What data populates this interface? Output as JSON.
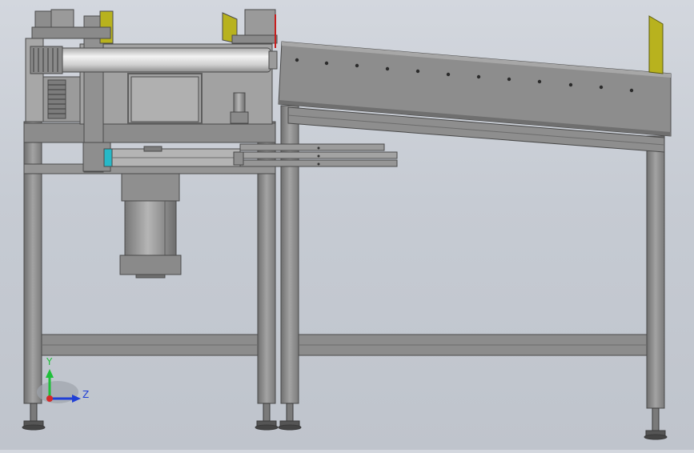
{
  "viewport": {
    "view_name": "cad-front-view",
    "background": "#c9cdd4"
  },
  "triad": {
    "y_label": "Y",
    "z_label": "Z",
    "y_color": "#1fbf3a",
    "z_color": "#1f3fd6",
    "x_color": "#d42a2a"
  },
  "colors": {
    "steel": "#8f8f8f",
    "steel_dark": "#6a6a6a",
    "steel_light": "#b5b5b5",
    "guide_plate": "#b8b21e",
    "roller": "#e6e6e6",
    "accent_red": "#c81e1e",
    "cyan_part": "#27b9c8"
  }
}
